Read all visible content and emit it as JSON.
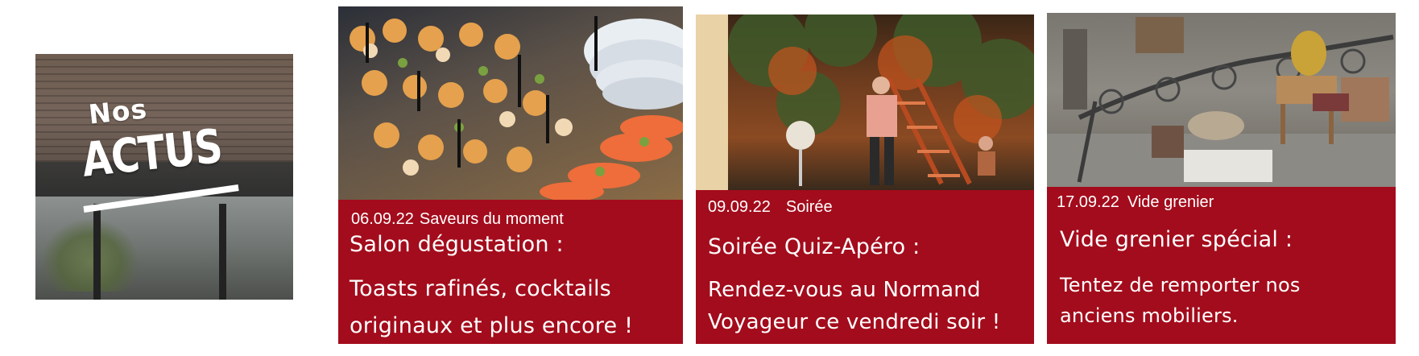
{
  "colors": {
    "band": "#a30c1c",
    "text": "#ffffff",
    "logo_text": "#ffffff"
  },
  "logo": {
    "small_text": "Nos",
    "big_text": "ACTUS"
  },
  "cards": [
    {
      "date": "06.09.22",
      "category": "Saveurs du moment",
      "title": "Salon dégustation :",
      "description_lines": [
        "Toasts rafinés, cocktails",
        "originaux et plus encore !"
      ],
      "photo_icon": "canape-platter-photo"
    },
    {
      "date": "09.09.22",
      "category": "Soirée",
      "title": "Soirée Quiz-Apéro :",
      "description_lines": [
        "Rendez-vous au Normand",
        "Voyageur ce vendredi soir !"
      ],
      "photo_icon": "terrace-evening-photo"
    },
    {
      "date": "17.09.22",
      "category": "Vide grenier",
      "title": "Vide grenier spécial :",
      "description_lines": [
        "Tentez de remporter nos",
        "anciens mobiliers."
      ],
      "photo_icon": "flea-market-photo"
    }
  ]
}
